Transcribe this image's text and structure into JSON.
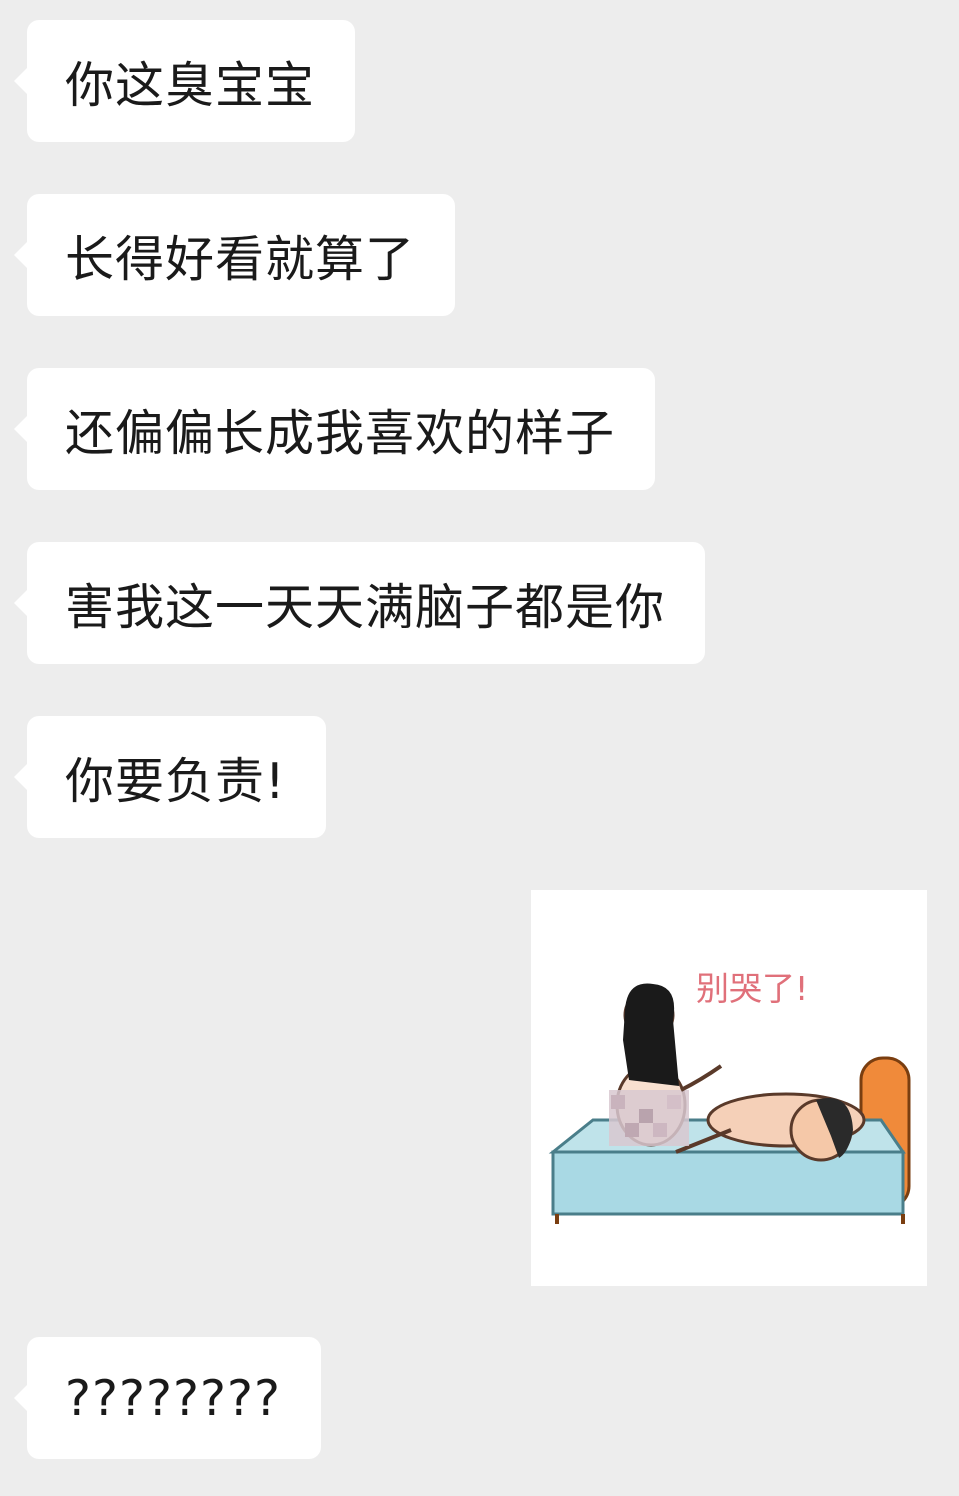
{
  "messages": [
    {
      "side": "left",
      "type": "text",
      "text": "你这臭宝宝"
    },
    {
      "side": "left",
      "type": "text",
      "text": "长得好看就算了"
    },
    {
      "side": "left",
      "type": "text",
      "text": "还偏偏长成我喜欢的样子"
    },
    {
      "side": "left",
      "type": "text",
      "text": "害我这一天天满脑子都是你"
    },
    {
      "side": "left",
      "type": "text",
      "text": "你要负责!"
    },
    {
      "side": "right",
      "type": "sticker",
      "caption": "别哭了!",
      "icon": "couple-on-bed-sticker"
    },
    {
      "side": "left",
      "type": "text",
      "text": "????????"
    }
  ],
  "colors": {
    "chat_background": "#ededed",
    "bubble_background": "#ffffff",
    "text": "#1a1a1a",
    "sticker_caption": "#e0707a"
  }
}
